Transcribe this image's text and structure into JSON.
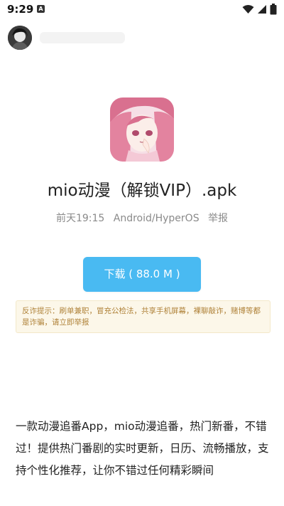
{
  "status_bar": {
    "time": "9:29",
    "notification_icon": "a-badge-icon",
    "icons": [
      "wifi-icon",
      "signal-icon",
      "battery-icon"
    ]
  },
  "header": {
    "avatar_icon": "user-avatar"
  },
  "app": {
    "icon": "anime-app-icon",
    "title": "mio动漫（解锁VIP）.apk",
    "meta": {
      "date": "前天19:15",
      "platform": "Android/HyperOS",
      "report_label": "举报"
    },
    "download_label": "下载 ( 88.0 M )",
    "warning_text": "反诈提示：刷单兼职，冒充公检法，共享手机屏幕，裸聊敲诈，赌博等都是诈骗，请立即举报",
    "description": "一款动漫追番App，mio动漫追番，热门新番，不错过！提供热门番剧的实时更新，日历、流畅播放，支持个性化推荐，让你不错过任何精彩瞬间"
  },
  "colors": {
    "download_button": "#49baf2",
    "warning_bg": "#fcf7e9",
    "warning_text": "#b0833a"
  }
}
